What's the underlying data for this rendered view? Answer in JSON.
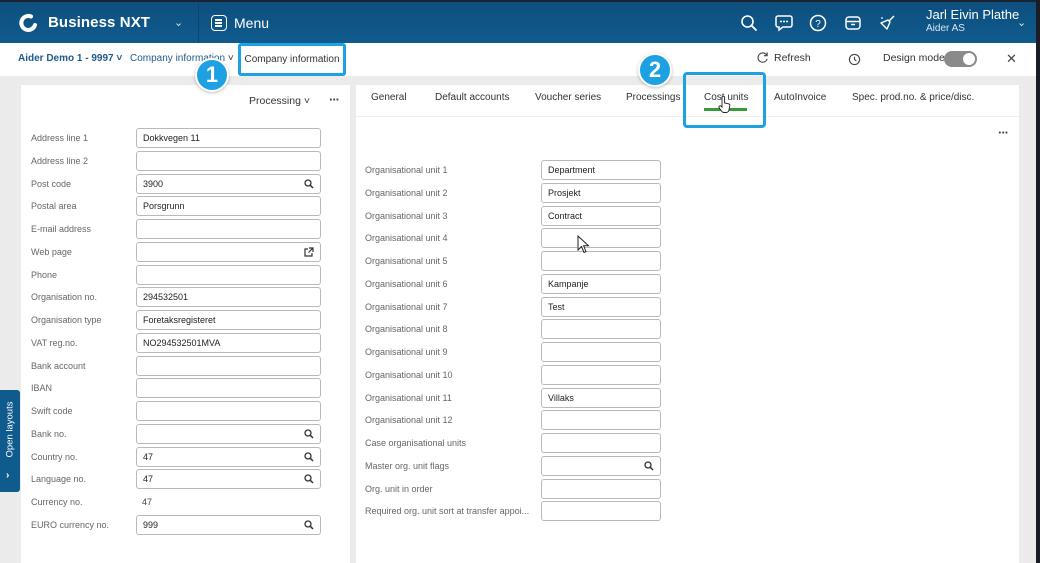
{
  "topbar": {
    "app_name": "Business NXT",
    "menu_label": "Menu",
    "icons": [
      "search-icon",
      "chat-icon",
      "help-icon",
      "inbox-icon",
      "broom-icon"
    ],
    "user_name": "Jarl Eivin Plathe",
    "user_company": "Aider AS"
  },
  "subbar": {
    "company": "Aider Demo 1 - 9997",
    "breadcrumb_section": "Company information",
    "active_view": "Company information",
    "refresh_label": "Refresh",
    "design_mode_label": "Design mode",
    "design_mode_on": true
  },
  "badges": {
    "one": "1",
    "two": "2"
  },
  "left_panel": {
    "processing_label": "Processing",
    "fields": [
      {
        "label": "Address line 1",
        "value": "Dokkvegen 11",
        "type": "input",
        "icon": ""
      },
      {
        "label": "Address line 2",
        "value": "",
        "type": "input",
        "icon": ""
      },
      {
        "label": "Post code",
        "value": "3900",
        "type": "input",
        "icon": "search"
      },
      {
        "label": "Postal area",
        "value": "Porsgrunn",
        "type": "input",
        "icon": ""
      },
      {
        "label": "E-mail address",
        "value": "",
        "type": "input",
        "icon": ""
      },
      {
        "label": "Web page",
        "value": "",
        "type": "input",
        "icon": "external-link"
      },
      {
        "label": "Phone",
        "value": "",
        "type": "input",
        "icon": ""
      },
      {
        "label": "Organisation no.",
        "value": "294532501",
        "type": "input",
        "icon": ""
      },
      {
        "label": "Organisation type",
        "value": "Foretaksregisteret",
        "type": "input",
        "icon": ""
      },
      {
        "label": "VAT reg.no.",
        "value": "NO294532501MVA",
        "type": "input",
        "icon": ""
      },
      {
        "label": "Bank account",
        "value": "",
        "type": "input",
        "icon": ""
      },
      {
        "label": "IBAN",
        "value": "",
        "type": "input",
        "icon": ""
      },
      {
        "label": "Swift code",
        "value": "",
        "type": "input",
        "icon": ""
      },
      {
        "label": "Bank no.",
        "value": "",
        "type": "input",
        "icon": "search"
      },
      {
        "label": "Country no.",
        "value": "47",
        "type": "input",
        "icon": "search"
      },
      {
        "label": "Language no.",
        "value": "47",
        "type": "input",
        "icon": "search"
      },
      {
        "label": "Currency no.",
        "value": "47",
        "type": "static",
        "icon": ""
      },
      {
        "label": "EURO currency no.",
        "value": "999",
        "type": "input",
        "icon": "search"
      }
    ]
  },
  "right_panel": {
    "tabs": [
      {
        "label": "General",
        "active": false
      },
      {
        "label": "Default accounts",
        "active": false
      },
      {
        "label": "Voucher series",
        "active": false
      },
      {
        "label": "Processings",
        "active": false
      },
      {
        "label": "Cost units",
        "active": true
      },
      {
        "label": "AutoInvoice",
        "active": false
      },
      {
        "label": "Spec. prod.no. & price/disc.",
        "active": false
      }
    ],
    "fields": [
      {
        "label": "Organisational unit 1",
        "value": "Department",
        "icon": ""
      },
      {
        "label": "Organisational unit 2",
        "value": "Prosjekt",
        "icon": ""
      },
      {
        "label": "Organisational unit 3",
        "value": "Contract",
        "icon": ""
      },
      {
        "label": "Organisational unit 4",
        "value": "",
        "icon": ""
      },
      {
        "label": "Organisational unit 5",
        "value": "",
        "icon": ""
      },
      {
        "label": "Organisational unit 6",
        "value": "Kampanje",
        "icon": ""
      },
      {
        "label": "Organisational unit 7",
        "value": "Test",
        "icon": ""
      },
      {
        "label": "Organisational unit 8",
        "value": "",
        "icon": ""
      },
      {
        "label": "Organisational unit 9",
        "value": "",
        "icon": ""
      },
      {
        "label": "Organisational unit 10",
        "value": "",
        "icon": ""
      },
      {
        "label": "Organisational unit 11",
        "value": "Villaks",
        "icon": ""
      },
      {
        "label": "Organisational unit 12",
        "value": "",
        "icon": ""
      },
      {
        "label": "Case organisational units",
        "value": "",
        "icon": ""
      },
      {
        "label": "Master org. unit flags",
        "value": "",
        "icon": "search"
      },
      {
        "label": "Org. unit in order",
        "value": "",
        "icon": ""
      },
      {
        "label": "Required org. unit sort at transfer appoi...",
        "value": "",
        "icon": ""
      }
    ]
  },
  "open_layouts_label": "Open layouts",
  "colors": {
    "brand_blue": "#0f5b8e",
    "highlight_blue": "#1ea1e3",
    "active_tab_green": "#3a9a3a"
  }
}
